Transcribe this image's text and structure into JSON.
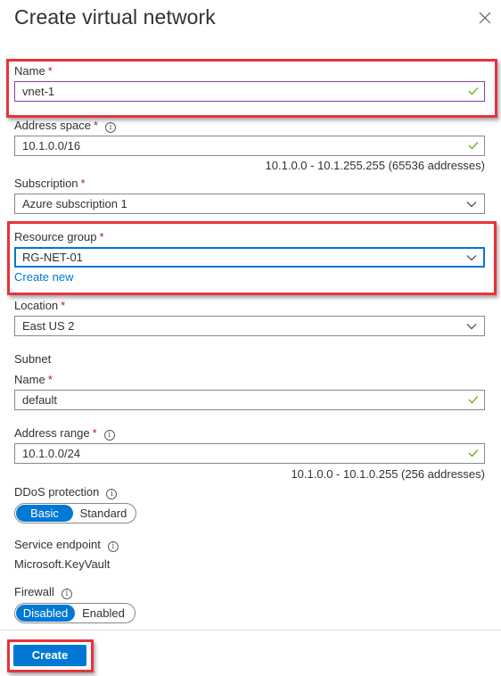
{
  "header": {
    "title": "Create virtual network",
    "close_icon": "close-icon"
  },
  "required_marker": "*",
  "info_glyph": "i",
  "fields": {
    "name": {
      "label": "Name",
      "value": "vnet-1",
      "valid": true
    },
    "address_space": {
      "label": "Address space",
      "value": "10.1.0.0/16",
      "valid": true,
      "hint": "10.1.0.0 - 10.1.255.255 (65536 addresses)"
    },
    "subscription": {
      "label": "Subscription",
      "value": "Azure subscription 1"
    },
    "resource_group": {
      "label": "Resource group",
      "value": "RG-NET-01",
      "create_new_label": "Create new"
    },
    "location": {
      "label": "Location",
      "value": "East US 2"
    }
  },
  "subnet": {
    "heading": "Subnet",
    "name": {
      "label": "Name",
      "value": "default",
      "valid": true
    },
    "address_range": {
      "label": "Address range",
      "value": "10.1.0.0/24",
      "valid": true,
      "hint": "10.1.0.0 - 10.1.0.255 (256 addresses)"
    }
  },
  "ddos": {
    "label": "DDoS protection",
    "options": [
      "Basic",
      "Standard"
    ],
    "selected": "Basic"
  },
  "service_endpoint": {
    "label": "Service endpoint",
    "value": "Microsoft.KeyVault"
  },
  "firewall": {
    "label": "Firewall",
    "options": [
      "Disabled",
      "Enabled"
    ],
    "selected": "Disabled"
  },
  "footer": {
    "create_label": "Create"
  },
  "colors": {
    "accent": "#0078d4",
    "required": "#a4262c",
    "valid_check": "#57a300",
    "highlight": "#e8333b",
    "focus_purple": "#8a3ea8"
  }
}
